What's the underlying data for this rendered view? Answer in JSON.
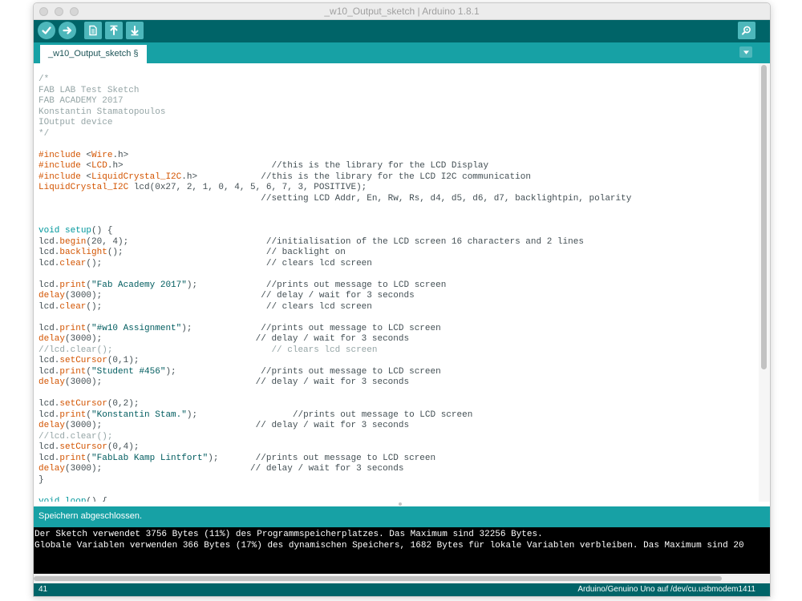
{
  "window": {
    "title": "_w10_Output_sketch | Arduino 1.8.1"
  },
  "toolbar": {
    "buttons": [
      {
        "name": "verify",
        "icon": "check-icon"
      },
      {
        "name": "upload",
        "icon": "arrow-right-icon"
      },
      {
        "name": "new",
        "icon": "document-icon"
      },
      {
        "name": "open",
        "icon": "arrow-up-icon"
      },
      {
        "name": "save",
        "icon": "arrow-down-icon"
      },
      {
        "name": "serial-monitor",
        "icon": "magnifier-icon"
      }
    ]
  },
  "tabs": [
    {
      "label": "_w10_Output_sketch §",
      "active": true
    }
  ],
  "editor": {
    "lines": [
      [
        [
          "comment",
          "/*"
        ]
      ],
      [
        [
          "comment",
          "FAB LAB Test Sketch"
        ]
      ],
      [
        [
          "comment",
          "FAB ACADEMY 2017"
        ]
      ],
      [
        [
          "comment",
          "Konstantin Stamatopoulos"
        ]
      ],
      [
        [
          "comment",
          "IOutput device"
        ]
      ],
      [
        [
          "comment",
          "*/"
        ]
      ],
      [],
      [
        [
          "keyword",
          "#include "
        ],
        [
          "plain",
          "<"
        ],
        [
          "keyword",
          "Wire"
        ],
        [
          "plain",
          ".h>"
        ]
      ],
      [
        [
          "keyword",
          "#include "
        ],
        [
          "plain",
          "<"
        ],
        [
          "keyword",
          "LCD"
        ],
        [
          "plain",
          ".h>                            //this is the library for the LCD Display"
        ]
      ],
      [
        [
          "keyword",
          "#include "
        ],
        [
          "plain",
          "<"
        ],
        [
          "keyword",
          "LiquidCrystal_I2C"
        ],
        [
          "plain",
          ".h>            //this is the library for the LCD I2C communication"
        ]
      ],
      [
        [
          "keyword",
          "LiquidCrystal_I2C"
        ],
        [
          "plain",
          " lcd(0x27, 2, 1, 0, 4, 5, 6, 7, 3, POSITIVE);"
        ]
      ],
      [
        [
          "plain",
          "                                          //setting LCD Addr, En, Rw, Rs, d4, d5, d6, d7, backlightpin, polarity"
        ]
      ],
      [],
      [],
      [
        [
          "type",
          "void"
        ],
        [
          "plain",
          " "
        ],
        [
          "type",
          "setup"
        ],
        [
          "plain",
          "() {"
        ]
      ],
      [
        [
          "plain",
          "lcd."
        ],
        [
          "keyword",
          "begin"
        ],
        [
          "plain",
          "(20, 4);                          //initialisation of the LCD screen 16 characters and 2 lines"
        ]
      ],
      [
        [
          "plain",
          "lcd."
        ],
        [
          "keyword",
          "backlight"
        ],
        [
          "plain",
          "();                           // backlight on"
        ]
      ],
      [
        [
          "plain",
          "lcd."
        ],
        [
          "keyword",
          "clear"
        ],
        [
          "plain",
          "();                               // clears lcd screen"
        ]
      ],
      [],
      [
        [
          "plain",
          "lcd."
        ],
        [
          "keyword",
          "print"
        ],
        [
          "plain",
          "("
        ],
        [
          "string",
          "\"Fab Academy 2017\""
        ],
        [
          "plain",
          ");             //prints out message to LCD screen"
        ]
      ],
      [
        [
          "keyword",
          "delay"
        ],
        [
          "plain",
          "(3000);                              // delay / wait for 3 seconds"
        ]
      ],
      [
        [
          "plain",
          "lcd."
        ],
        [
          "keyword",
          "clear"
        ],
        [
          "plain",
          "();                               // clears lcd screen"
        ]
      ],
      [],
      [
        [
          "plain",
          "lcd."
        ],
        [
          "keyword",
          "print"
        ],
        [
          "plain",
          "("
        ],
        [
          "string",
          "\"#w10 Assignment\""
        ],
        [
          "plain",
          ");             //prints out message to LCD screen"
        ]
      ],
      [
        [
          "keyword",
          "delay"
        ],
        [
          "plain",
          "(3000);                             // delay / wait for 3 seconds"
        ]
      ],
      [
        [
          "comment",
          "//lcd.clear();                              // clears lcd screen"
        ]
      ],
      [
        [
          "plain",
          "lcd."
        ],
        [
          "keyword",
          "setCursor"
        ],
        [
          "plain",
          "(0,1);"
        ]
      ],
      [
        [
          "plain",
          "lcd."
        ],
        [
          "keyword",
          "print"
        ],
        [
          "plain",
          "("
        ],
        [
          "string",
          "\"Student #456\""
        ],
        [
          "plain",
          ");                //prints out message to LCD screen"
        ]
      ],
      [
        [
          "keyword",
          "delay"
        ],
        [
          "plain",
          "(3000);                             // delay / wait for 3 seconds"
        ]
      ],
      [],
      [
        [
          "plain",
          "lcd."
        ],
        [
          "keyword",
          "setCursor"
        ],
        [
          "plain",
          "(0,2);"
        ]
      ],
      [
        [
          "plain",
          "lcd."
        ],
        [
          "keyword",
          "print"
        ],
        [
          "plain",
          "("
        ],
        [
          "string",
          "\"Konstantin Stam.\""
        ],
        [
          "plain",
          ");                  //prints out message to LCD screen"
        ]
      ],
      [
        [
          "keyword",
          "delay"
        ],
        [
          "plain",
          "(3000);                             // delay / wait for 3 seconds"
        ]
      ],
      [
        [
          "comment",
          "//lcd.clear();"
        ]
      ],
      [
        [
          "plain",
          "lcd."
        ],
        [
          "keyword",
          "setCursor"
        ],
        [
          "plain",
          "(0,4);"
        ]
      ],
      [
        [
          "plain",
          "lcd."
        ],
        [
          "keyword",
          "print"
        ],
        [
          "plain",
          "("
        ],
        [
          "string",
          "\"FabLab Kamp Lintfort\""
        ],
        [
          "plain",
          ");       //prints out message to LCD screen"
        ]
      ],
      [
        [
          "keyword",
          "delay"
        ],
        [
          "plain",
          "(3000);                            // delay / wait for 3 seconds"
        ]
      ],
      [
        [
          "plain",
          "}"
        ]
      ],
      [],
      [
        [
          "type",
          "void"
        ],
        [
          "plain",
          " "
        ],
        [
          "type",
          "loop"
        ],
        [
          "plain",
          "() {"
        ]
      ]
    ]
  },
  "status": {
    "message": "Speichern abgeschlossen."
  },
  "console": {
    "lines": [
      "Der Sketch verwendet 3756 Bytes (11%) des Programmspeicherplatzes. Das Maximum sind 32256 Bytes.",
      "Globale Variablen verwenden 366 Bytes (17%) des dynamischen Speichers, 1682 Bytes für lokale Variablen verbleiben. Das Maximum sind 20"
    ]
  },
  "footer": {
    "line_number": "41",
    "board": "Arduino/Genuino Uno auf /dev/cu.usbmodem1411"
  },
  "colors": {
    "toolbar_bg": "#006468",
    "tab_bar_bg": "#17a1a5",
    "button_bg": "#4db7bb",
    "comment": "#95a5a6",
    "keyword": "#d35400",
    "type": "#00979c",
    "string": "#005c5f",
    "plain": "#434f54"
  }
}
